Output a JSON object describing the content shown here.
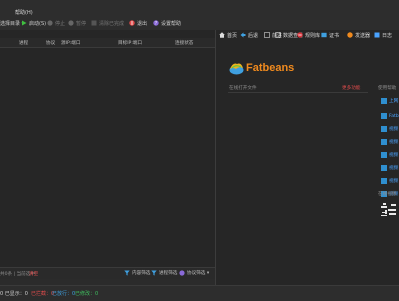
{
  "menu": {
    "help": "帮助(H)"
  },
  "toolbar": {
    "item0": "选择目录 ▾",
    "start": "启动(S)",
    "stop": "停止",
    "pause": "暂停",
    "disabled": "清除已完成",
    "quit": "退出",
    "settings": "设置帮助"
  },
  "columns": [
    "进程",
    "协议",
    "源IP:端口",
    "目标IP:端口",
    "连接状态"
  ],
  "nav": [
    {
      "label": "首页",
      "icon": "home-icon",
      "color": "#dcdcdc"
    },
    {
      "label": "后退",
      "icon": "back-icon",
      "color": "#3fa0e0"
    },
    {
      "label": "前进",
      "icon": "forward-icon",
      "color": "#aaaaaa"
    },
    {
      "label": "数据查看",
      "icon": "doc-icon",
      "color": "#e06c3a"
    },
    {
      "label": "规则库",
      "icon": "rules-icon",
      "color": "#d9363e"
    },
    {
      "label": "证书",
      "icon": "cert-icon",
      "color": "#3fa0e0"
    },
    {
      "label": "发送器",
      "icon": "send-icon",
      "color": "#f08a1e"
    },
    {
      "label": "日志",
      "icon": "log-icon",
      "color": "#4aa3ff"
    }
  ],
  "right_panel": {
    "brand": "Fatbeans",
    "search_label": "在线打开文件",
    "link_label": "更多功能",
    "side_title": "使用帮助",
    "bottom_title": "在线视频",
    "list": [
      "上网",
      "Fatb",
      "视频",
      "视频",
      "视频",
      "视频",
      "视频",
      "视频"
    ]
  },
  "bottom_bar": {
    "left": "共0条 | 当前选中:",
    "left_link": "清空",
    "filter1": "内容筛选",
    "filter2": "进程筛选",
    "filter3": "协议筛选 ▾"
  },
  "status": [
    {
      "label": "0 已显示：0",
      "color": "#cfcfcf"
    },
    {
      "label": "已拦截：0",
      "color": "#e24c4c"
    },
    {
      "label": "已放行：0",
      "color": "#3fa0e0"
    },
    {
      "label": "已修改：0",
      "color": "#3fbf5f"
    }
  ],
  "colors": {
    "accent": "#f08a1e",
    "link": "#4aa3ff",
    "start_green": "#3fbf3f",
    "quit_red": "#e24c4c"
  }
}
